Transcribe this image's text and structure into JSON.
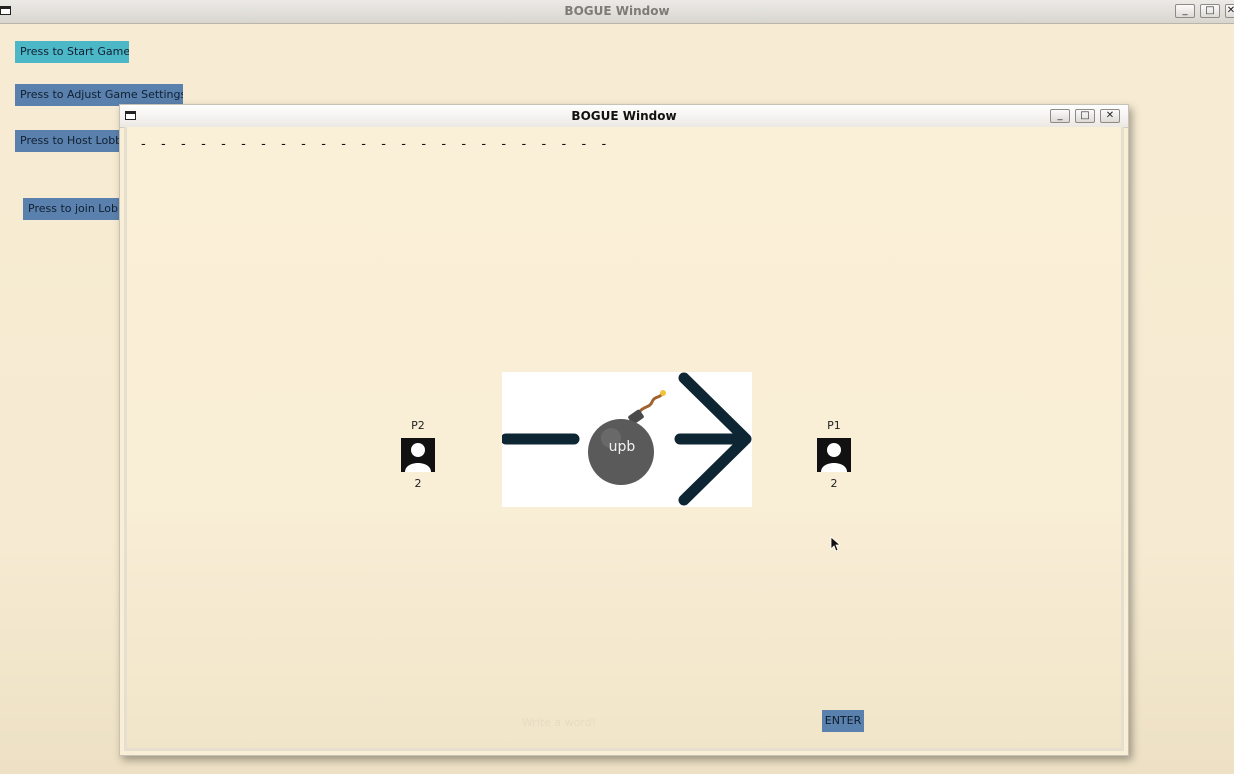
{
  "main_window": {
    "title": "BOGUE Window",
    "buttons": {
      "start": "Press to Start Game",
      "settings": "Press to Adjust Game Settings",
      "host": "Press to Host Lobb",
      "join": "Press to join Lobb"
    },
    "controls": {
      "minimize": "_",
      "maximize": "□",
      "close": "✕"
    }
  },
  "dialog": {
    "title": "BOGUE Window",
    "controls": {
      "minimize": "_",
      "maximize": "□",
      "close": "✕"
    },
    "word_mask": "- - - - - - - - - - - - - - - - - - - - - - - -",
    "players": [
      {
        "label": "P2",
        "score": "2"
      },
      {
        "label": "P1",
        "score": "2"
      }
    ],
    "bomb_text": "upb",
    "input_placeholder": "Write a word!",
    "enter_label": "ENTER"
  },
  "colors": {
    "background": "#f7ecd3",
    "button_blue": "#5a80ad",
    "button_cyan": "#4cb7c7",
    "arrow": "#0e2533",
    "bomb": "#5a5a5a"
  }
}
